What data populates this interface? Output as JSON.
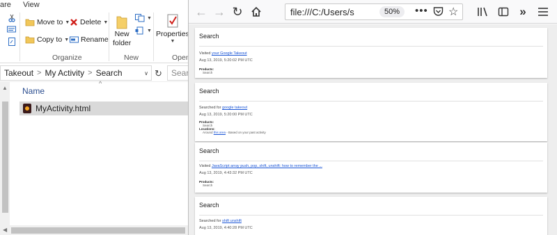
{
  "explorer": {
    "ribbon_tabs": [
      "are",
      "View"
    ],
    "ribbon": {
      "move_to": "Move to",
      "copy_to": "Copy to",
      "delete": "Delete",
      "rename": "Rename",
      "new_folder_line1": "New",
      "new_folder_line2": "folder",
      "properties": "Properties",
      "groups": {
        "organize": "Organize",
        "new": "New",
        "open": "Open"
      }
    },
    "breadcrumb": [
      "Takeout",
      "My Activity",
      "Search"
    ],
    "search_placeholder": "Searc",
    "column_header": "Name",
    "files": [
      {
        "name": "MyActivity.html"
      }
    ]
  },
  "browser": {
    "url": "file:///C:/Users/s",
    "zoom": "50%",
    "cards": [
      {
        "header": "Search",
        "prefix": "Visited ",
        "link": "your Google Takeout",
        "time": "Aug 13, 2019, 5:20:02 PM UTC",
        "products_label": "Products:",
        "products_value": "Search"
      },
      {
        "header": "Search",
        "prefix": "Searched for ",
        "link": "google takeout",
        "time": "Aug 13, 2019, 5:20:00 PM UTC",
        "products_label": "Products:",
        "products_value": "Search",
        "locations_label": "Locations:",
        "locations_prefix": "Around ",
        "locations_link": "this area",
        "locations_suffix": " - Based on your past activity"
      },
      {
        "header": "Search",
        "prefix": "Visited ",
        "link": "JavaScript array push, pop, shift, unshift: how to remember the ...",
        "time": "Aug 13, 2019, 4:43:32 PM UTC",
        "products_label": "Products:",
        "products_value": "Search"
      },
      {
        "header": "Search",
        "prefix": "Searched for ",
        "link": "shift unshift",
        "time": "Aug 13, 2019, 4:40:28 PM UTC"
      }
    ]
  },
  "colors": {
    "link": "#1a55d6",
    "selection": "#d9d9d9",
    "content_bg": "#eeeeee"
  }
}
